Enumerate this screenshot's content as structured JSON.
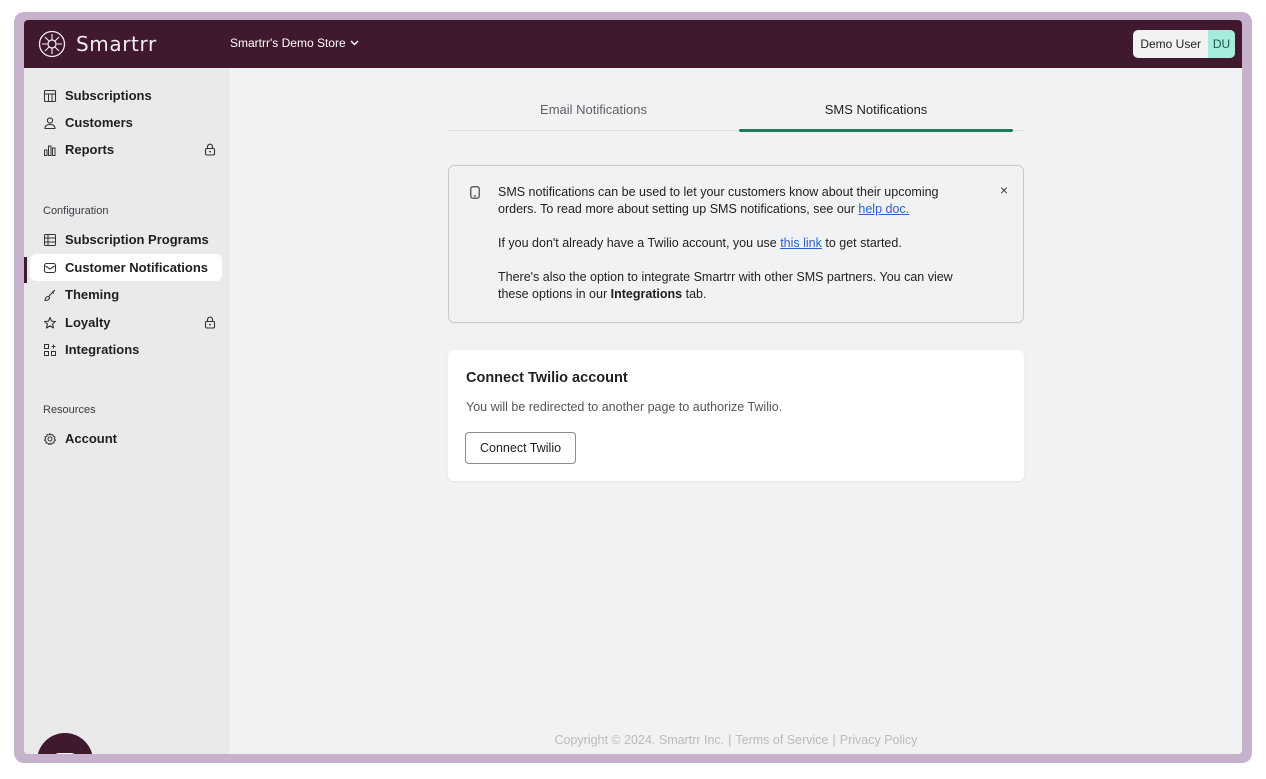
{
  "app": {
    "brand": "Smartrr",
    "store_name": "Smartrr's Demo Store",
    "user_name": "Demo User",
    "user_initials": "DU"
  },
  "sidebar": {
    "items_main": [
      {
        "label": "Subscriptions",
        "icon": "table-icon"
      },
      {
        "label": "Customers",
        "icon": "person-icon"
      },
      {
        "label": "Reports",
        "icon": "bar-chart-icon",
        "locked": true
      }
    ],
    "config_label": "Configuration",
    "items_config": [
      {
        "label": "Subscription Programs",
        "icon": "list-icon"
      },
      {
        "label": "Customer Notifications",
        "icon": "mail-icon",
        "active": true
      },
      {
        "label": "Theming",
        "icon": "brush-icon"
      },
      {
        "label": "Loyalty",
        "icon": "star-icon",
        "locked": true
      },
      {
        "label": "Integrations",
        "icon": "apps-icon"
      }
    ],
    "resources_label": "Resources",
    "items_resources": [
      {
        "label": "Account",
        "icon": "gear-icon"
      }
    ]
  },
  "tabs": {
    "email": "Email Notifications",
    "sms": "SMS Notifications",
    "active": "sms"
  },
  "info": {
    "p1_text": "SMS notifications can be used to let your customers know about their upcoming orders. To read more about setting up SMS notifications, see our",
    "p1_link": "help doc.",
    "p2_before": "If you don't already have a Twilio account, you use",
    "p2_link": "this link",
    "p2_after": "to get started.",
    "p3_before": "There's also the option to integrate Smartrr with other SMS partners. You can view these options in our",
    "p3_bold": "Integrations",
    "p3_after": "tab.",
    "close_glyph": "×"
  },
  "card": {
    "title": "Connect Twilio account",
    "description": "You will be redirected to another page to authorize Twilio.",
    "button": "Connect Twilio"
  },
  "footer": {
    "copyright": "Copyright © 2024. Smartrr Inc.",
    "terms": "Terms of Service",
    "privacy": "Privacy Policy",
    "separator": "|"
  },
  "colors": {
    "topbar": "#40192f",
    "accent": "#1f7a5c",
    "link": "#2962c9"
  }
}
